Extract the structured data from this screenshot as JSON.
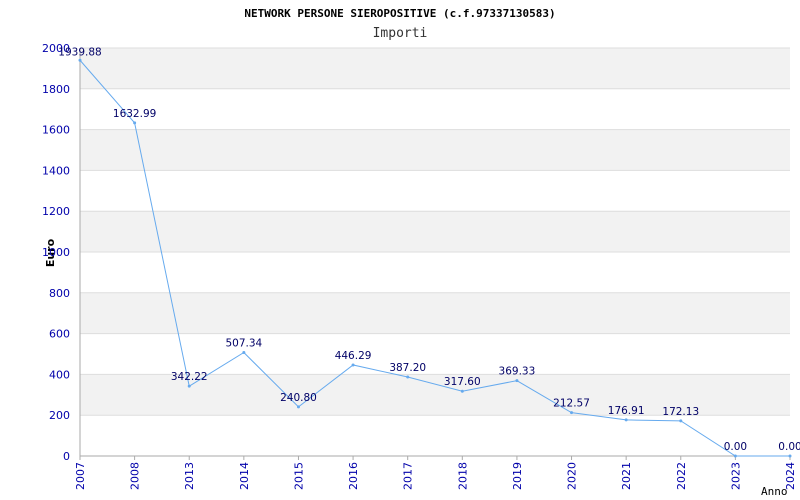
{
  "chart_data": {
    "type": "line",
    "title": "NETWORK PERSONE SIEROPOSITIVE (c.f.97337130583)",
    "subtitle": "Importi",
    "xlabel": "Anno",
    "ylabel": "Euro",
    "ylim": [
      0,
      2000
    ],
    "yticks": [
      0,
      200,
      400,
      600,
      800,
      1000,
      1200,
      1400,
      1600,
      1800,
      2000
    ],
    "categories": [
      "2007",
      "2008",
      "2013",
      "2014",
      "2015",
      "2016",
      "2017",
      "2018",
      "2019",
      "2020",
      "2021",
      "2022",
      "2023",
      "2024"
    ],
    "values": [
      1939.88,
      1632.99,
      342.22,
      507.34,
      240.8,
      446.29,
      387.2,
      317.6,
      369.33,
      212.57,
      176.91,
      172.13,
      0.0,
      0.0
    ],
    "data_labels": [
      "1939.88",
      "1632.99",
      "342.22",
      "507.34",
      "240.80",
      "446.29",
      "387.20",
      "317.60",
      "369.33",
      "212.57",
      "176.91",
      "172.13",
      "0.00",
      "0.00"
    ],
    "grid": true,
    "colors": {
      "line": "#66aaee",
      "band": "#f2f2f2",
      "tick_text": "#0000aa",
      "label_text": "#000066",
      "title_text": "#000000"
    }
  }
}
